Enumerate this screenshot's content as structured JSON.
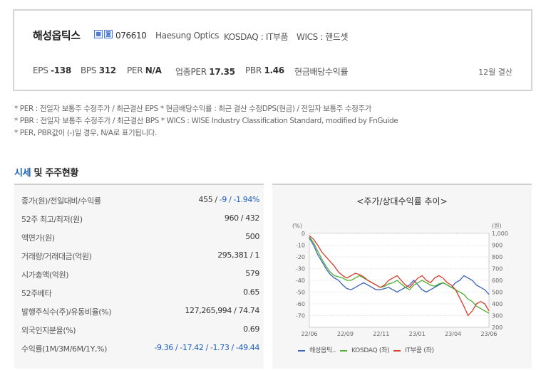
{
  "company": {
    "name": "해성옵틱스",
    "badge1": "■",
    "badge2": "◙",
    "code": "076610",
    "english_name": "Haesung Optics",
    "market": "KOSDAQ : IT부품",
    "wics": "WICS : 핸드셋"
  },
  "metrics": {
    "eps_label": "EPS",
    "eps_value": "-138",
    "bps_label": "BPS",
    "bps_value": "312",
    "per_label": "PER",
    "per_value": "N/A",
    "ind_per_label": "업종PER",
    "ind_per_value": "17.35",
    "pbr_label": "PBR",
    "pbr_value": "1.46",
    "div_label": "현금배당수익률",
    "settlement": "12월 결산"
  },
  "notes": [
    "* PER : 전일자 보통주 수정주가 / 최근결산 EPS * 현금배당수익률 : 최근 결산 수정DPS(현금) / 전일자 보통주 수정주가",
    "* PBR : 전일자 보통주 수정주가 / 최근결산 BPS * WICS : WISE Industry Classification Standard, modified by FnGuide",
    "* PER, PBR값이 (-)일 경우, N/A로 표기됩니다."
  ],
  "section": {
    "title_hl": "시세",
    "title_rest": " 및 주주현황"
  },
  "table": {
    "rows": [
      {
        "label": "종가(원)/전일대비/수익률",
        "v1": "455 / ",
        "v2": "-9 / -1.94%"
      },
      {
        "label": "52주 최고/최저(원)",
        "v1": "960 / 432",
        "v2": ""
      },
      {
        "label": "액면가(원)",
        "v1": "500",
        "v2": ""
      },
      {
        "label": "거래량/거래대금(억원)",
        "v1": "295,381 / 1",
        "v2": ""
      },
      {
        "label": "시가총액(억원)",
        "v1": "579",
        "v2": ""
      },
      {
        "label": "52주베타",
        "v1": "0.65",
        "v2": ""
      },
      {
        "label": "발행주식수(주)/유동비율(%)",
        "v1": "127,265,994 / 74.74",
        "v2": ""
      },
      {
        "label": "외국인지분율(%)",
        "v1": "0.69",
        "v2": ""
      },
      {
        "label": "수익률(1M/3M/6M/1Y,%)",
        "v1": "",
        "v2": "-9.36 / -17.42 / -1.73 / -49.44"
      }
    ]
  },
  "chart_data": {
    "type": "line",
    "title": "<주가/상대수익률 추이>",
    "y_left_unit": "(%)",
    "y_right_unit": "(원)",
    "y_left_ticks": [
      0,
      -10,
      -20,
      -30,
      -40,
      -50,
      -60,
      -70
    ],
    "y_right_ticks": [
      1000,
      900,
      800,
      700,
      600,
      500,
      400,
      300,
      200
    ],
    "x_ticks": [
      "22/06",
      "22/09",
      "22/11",
      "23/01",
      "23/04",
      "23/06"
    ],
    "ylim_left": [
      -80,
      0
    ],
    "ylim_right": [
      200,
      1000
    ],
    "series": [
      {
        "name": "해성옵틱..",
        "axis": "right",
        "color": "#3a63b8",
        "values": [
          960,
          900,
          820,
          760,
          700,
          650,
          620,
          600,
          560,
          530,
          520,
          540,
          560,
          580,
          560,
          540,
          520,
          520,
          530,
          540,
          520,
          500,
          520,
          540,
          560,
          600,
          560,
          520,
          500,
          520,
          540,
          560,
          580,
          560,
          540,
          580,
          600,
          640,
          620,
          600,
          560,
          540,
          520,
          480
        ]
      },
      {
        "name": "KOSDAQ (좌)",
        "axis": "left",
        "color": "#4caf2f",
        "values": [
          -3,
          -8,
          -15,
          -22,
          -28,
          -33,
          -36,
          -37,
          -38,
          -40,
          -40,
          -38,
          -36,
          -38,
          -40,
          -42,
          -44,
          -46,
          -45,
          -43,
          -42,
          -40,
          -43,
          -46,
          -48,
          -44,
          -42,
          -40,
          -42,
          -44,
          -45,
          -43,
          -42,
          -44,
          -46,
          -48,
          -50,
          -52,
          -56,
          -58,
          -62,
          -64,
          -66,
          -68
        ]
      },
      {
        "name": "IT부품 (좌)",
        "axis": "left",
        "color": "#d83a2a",
        "values": [
          -2,
          -5,
          -10,
          -16,
          -20,
          -24,
          -28,
          -33,
          -36,
          -38,
          -36,
          -34,
          -35,
          -37,
          -40,
          -42,
          -44,
          -46,
          -44,
          -40,
          -38,
          -36,
          -40,
          -44,
          -46,
          -42,
          -38,
          -36,
          -40,
          -42,
          -38,
          -36,
          -38,
          -42,
          -44,
          -48,
          -55,
          -62,
          -70,
          -66,
          -60,
          -58,
          -60,
          -66
        ]
      }
    ]
  }
}
